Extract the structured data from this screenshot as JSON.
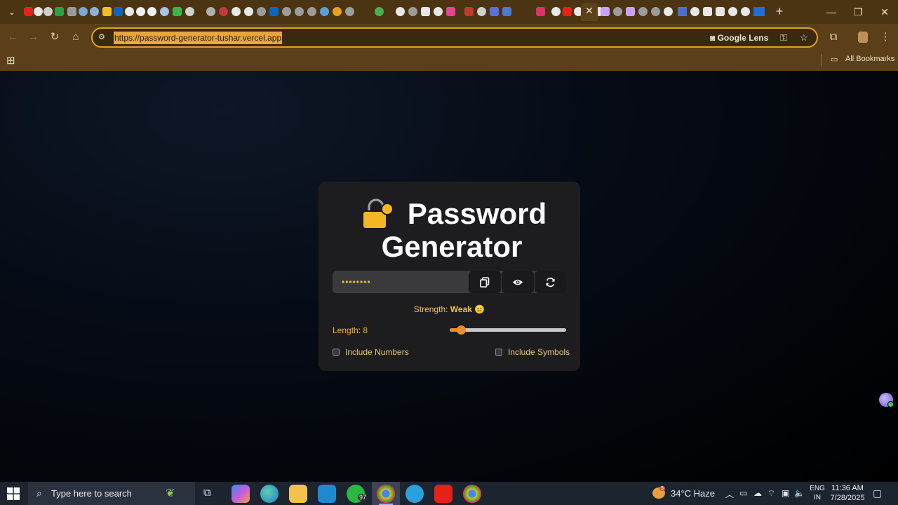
{
  "browser": {
    "url": "https://password-generator-tushar.vercel.app",
    "lens_label": "Google Lens",
    "bookmarks_label": "All Bookmarks",
    "new_tab": "+",
    "close_tab": "✕"
  },
  "app": {
    "title_line1": "Password",
    "title_line2": "Generator",
    "password_masked": "••••••••",
    "strength_label": "Strength:",
    "strength_value": "Weak",
    "strength_emoji": "😐",
    "length_label": "Length: 8",
    "length": 8,
    "length_fraction": 0.1,
    "include_numbers_label": "Include Numbers",
    "include_numbers": false,
    "include_symbols_label": "Include Symbols",
    "include_symbols": false,
    "buttons": [
      "copy-icon",
      "eye-icon",
      "refresh-icon"
    ]
  },
  "taskbar": {
    "search_placeholder": "Type here to search",
    "weather": "34°C  Haze",
    "weather_badge": "5",
    "lang_line1": "ENG",
    "lang_line2": "IN",
    "time": "11:36 AM",
    "date": "7/28/2025",
    "whatsapp_badge": "97"
  },
  "colors": {
    "chrome": "#5b3f18",
    "accent": "#f28c28",
    "password_text": "#f5c518",
    "card": "#1d1d1f"
  }
}
